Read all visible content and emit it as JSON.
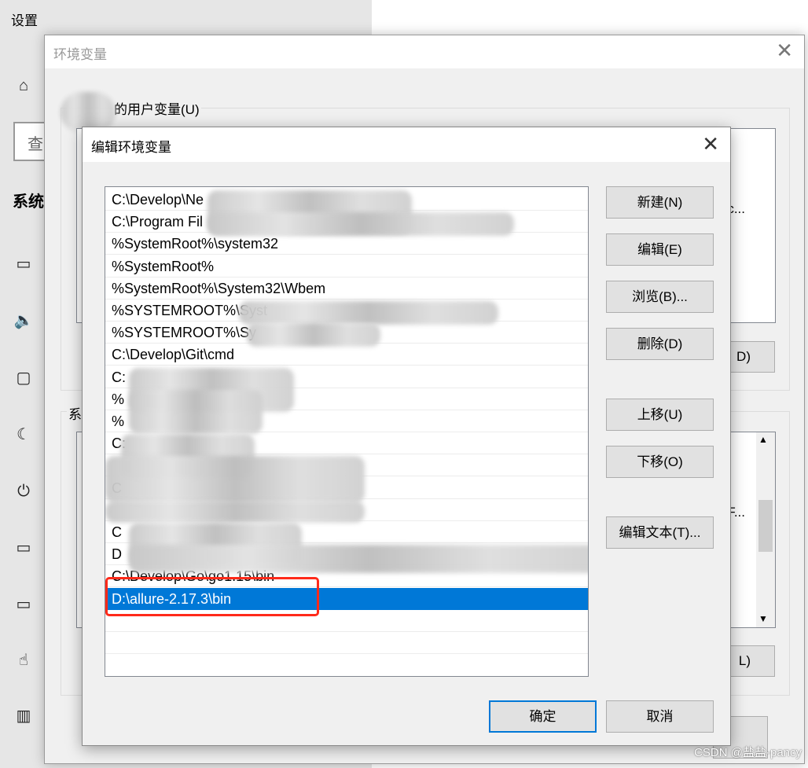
{
  "settings": {
    "title": "设置",
    "search_label": "查",
    "section": "系统",
    "nav_icons": [
      "home-icon",
      "display-icon",
      "sound-icon",
      "notifications-icon",
      "focus-assist-icon",
      "power-icon",
      "battery-icon",
      "storage-icon",
      "tablet-icon",
      "multitasking-icon"
    ]
  },
  "env_dialog": {
    "title": "环境变量",
    "user_group": "的用户变量(U)",
    "system_group": "系",
    "user_trunc": "c...",
    "system_trunc": "F...",
    "user_delete": "D)",
    "system_delete": "L)"
  },
  "edit_dialog": {
    "title": "编辑环境变量",
    "entries": [
      {
        "text": "C:\\Develop\\Ne",
        "redacted": true
      },
      {
        "text": "C:\\Program Fil",
        "redacted": true
      },
      {
        "text": "%SystemRoot%\\system32",
        "redacted": true
      },
      {
        "text": "%SystemRoot%",
        "redacted": false
      },
      {
        "text": "%SystemRoot%\\System32\\Wbem",
        "redacted": false
      },
      {
        "text": "%SYSTEMROOT%\\Syst",
        "redacted": true
      },
      {
        "text": "%SYSTEMROOT%\\Sy",
        "redacted": true
      },
      {
        "text": "C:\\Develop\\Git\\cmd",
        "redacted": true
      },
      {
        "text": "C:",
        "redacted": true
      },
      {
        "text": "%",
        "redacted": true
      },
      {
        "text": "%",
        "redacted": true
      },
      {
        "text": "C:",
        "redacted": true
      },
      {
        "text": "",
        "redacted": true
      },
      {
        "text": "C",
        "redacted": true
      },
      {
        "text": "",
        "redacted": true
      },
      {
        "text": "C",
        "redacted": true
      },
      {
        "text": "D",
        "redacted": true
      },
      {
        "text": "C:\\Develop\\Go\\go1.15\\bin",
        "redacted": true
      },
      {
        "text": "D:\\allure-2.17.3\\bin",
        "redacted": false,
        "selected": true
      },
      {
        "text": "",
        "redacted": false
      },
      {
        "text": "",
        "redacted": false
      }
    ],
    "buttons": {
      "new": "新建(N)",
      "edit": "编辑(E)",
      "browse": "浏览(B)...",
      "delete": "删除(D)",
      "move_up": "上移(U)",
      "move_down": "下移(O)",
      "edit_text": "编辑文本(T)...",
      "ok": "确定",
      "cancel": "取消"
    },
    "highlight_color": "#ff2a1a",
    "selection_color": "#0078d7"
  },
  "watermark": "CSDN @盐盐-pancy"
}
